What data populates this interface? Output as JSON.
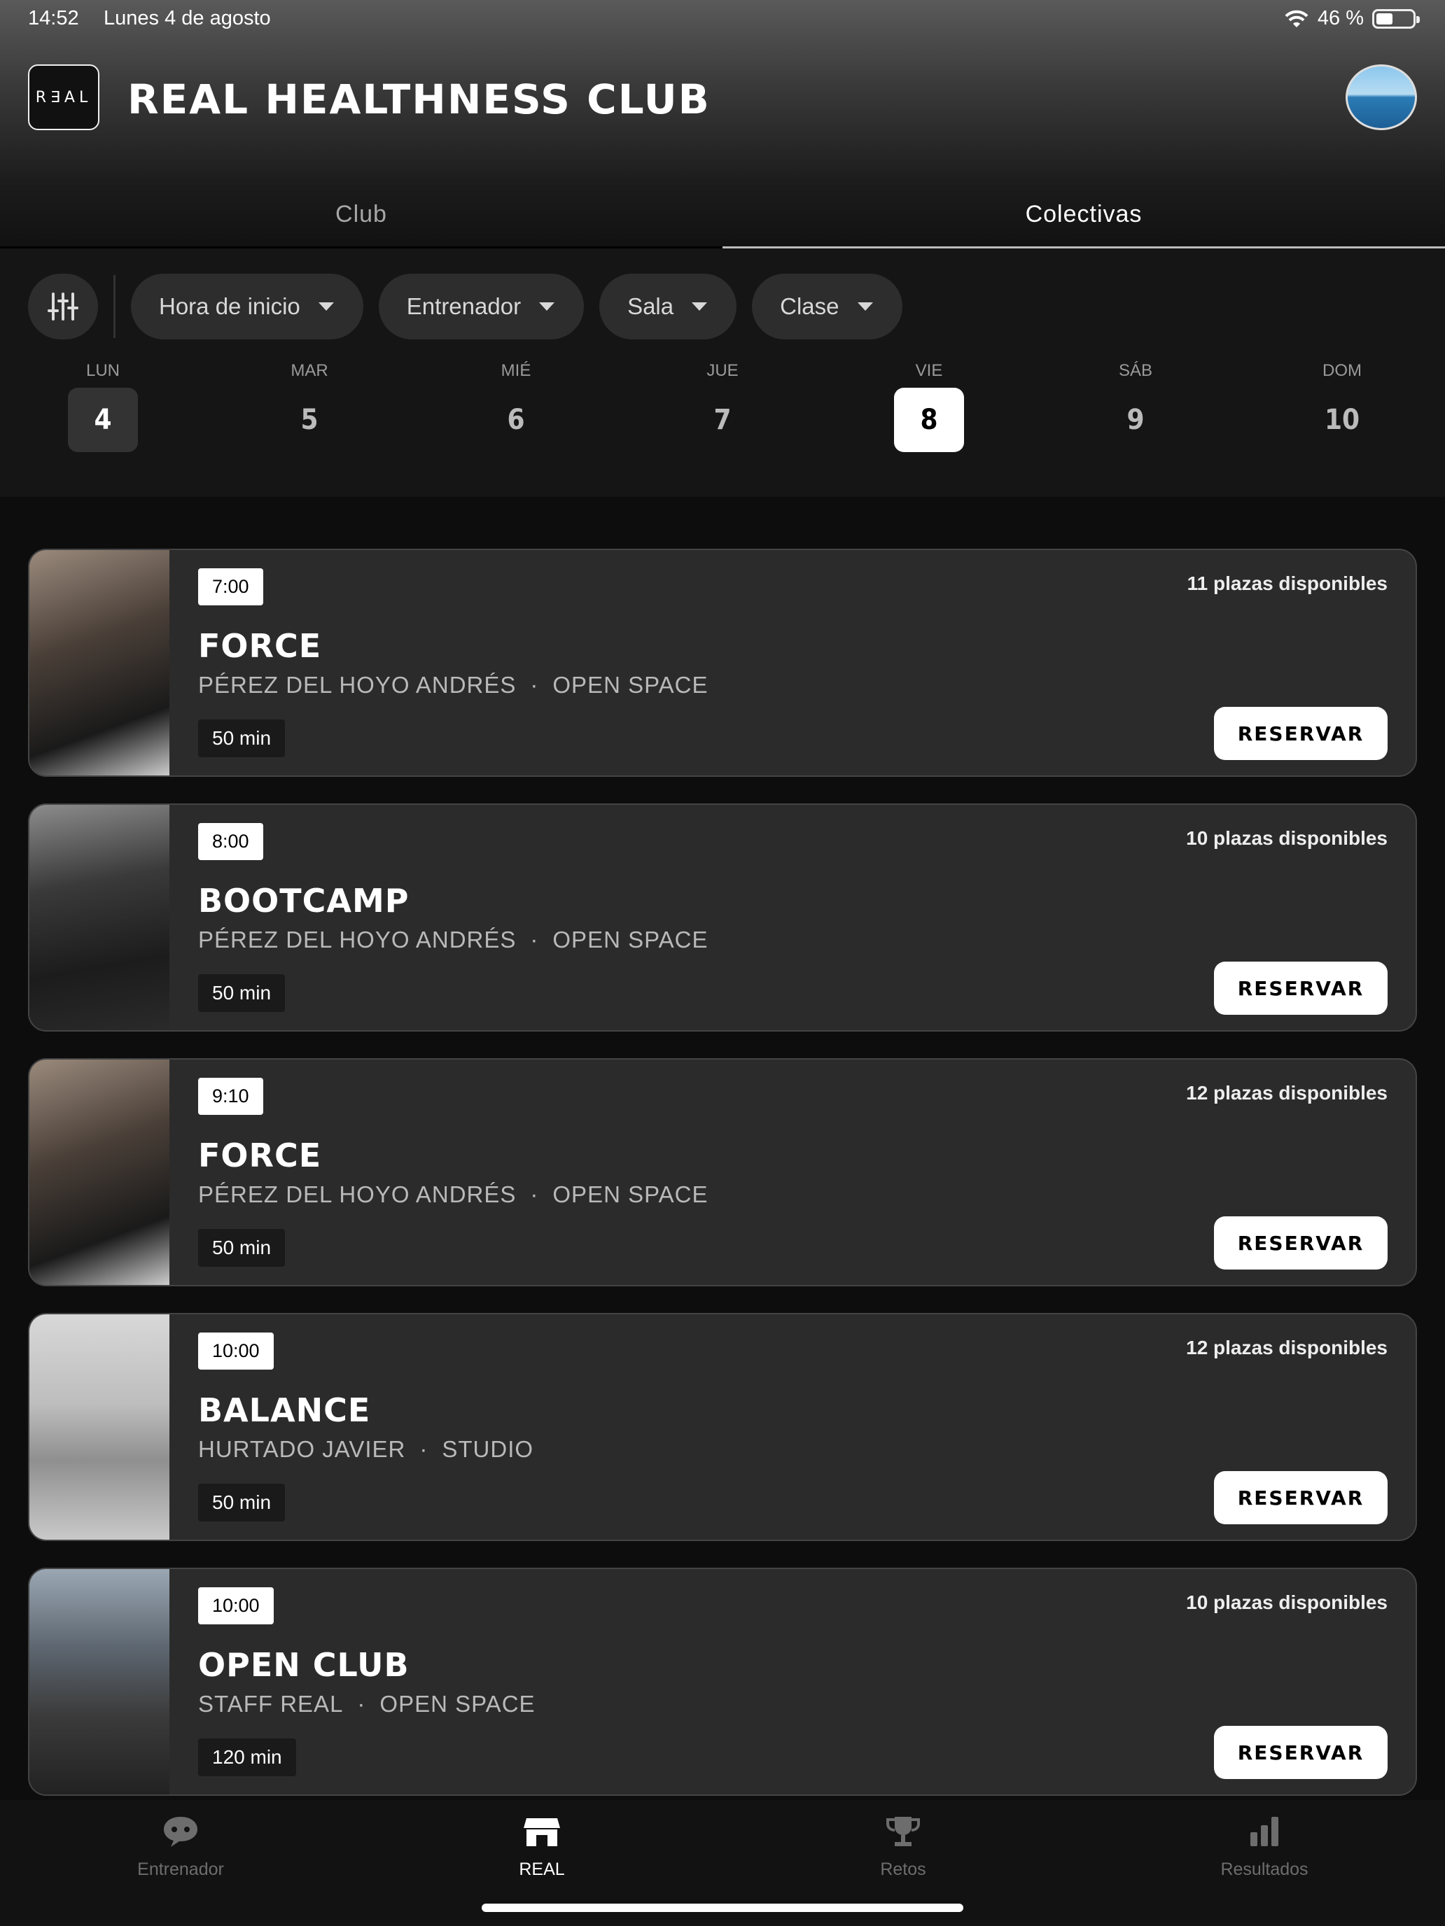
{
  "status": {
    "time": "14:52",
    "date": "Lunes 4 de agosto",
    "battery": "46 %",
    "battery_level": 0.46
  },
  "header": {
    "logo_text": "R∃AL",
    "title": "REAL HEALTHNESS CLUB",
    "avatar": "profile-avatar"
  },
  "tabs": [
    {
      "label": "Club",
      "active": false
    },
    {
      "label": "Colectivas",
      "active": true
    }
  ],
  "filters": {
    "icon": "sliders-icon",
    "chips": [
      {
        "label": "Hora de inicio"
      },
      {
        "label": "Entrenador"
      },
      {
        "label": "Sala"
      },
      {
        "label": "Clase"
      }
    ]
  },
  "days": [
    {
      "name": "LUN",
      "num": "4",
      "state": "today"
    },
    {
      "name": "MAR",
      "num": "5",
      "state": ""
    },
    {
      "name": "MIÉ",
      "num": "6",
      "state": ""
    },
    {
      "name": "JUE",
      "num": "7",
      "state": ""
    },
    {
      "name": "VIE",
      "num": "8",
      "state": "selected"
    },
    {
      "name": "SÁB",
      "num": "9",
      "state": ""
    },
    {
      "name": "DOM",
      "num": "10",
      "state": ""
    }
  ],
  "classes": [
    {
      "time": "7:00",
      "name": "FORCE",
      "trainer": "PÉREZ DEL HOYO ANDRÉS",
      "room": "OPEN SPACE",
      "duration": "50 min",
      "places": "11 plazas disponibles",
      "button": "RESERVAR"
    },
    {
      "time": "8:00",
      "name": "BOOTCAMP",
      "trainer": "PÉREZ DEL HOYO ANDRÉS",
      "room": "OPEN SPACE",
      "duration": "50 min",
      "places": "10 plazas disponibles",
      "button": "RESERVAR"
    },
    {
      "time": "9:10",
      "name": "FORCE",
      "trainer": "PÉREZ DEL HOYO ANDRÉS",
      "room": "OPEN SPACE",
      "duration": "50 min",
      "places": "12 plazas disponibles",
      "button": "RESERVAR"
    },
    {
      "time": "10:00",
      "name": "BALANCE",
      "trainer": "HURTADO JAVIER",
      "room": "STUDIO",
      "duration": "50 min",
      "places": "12 plazas disponibles",
      "button": "RESERVAR"
    },
    {
      "time": "10:00",
      "name": "OPEN CLUB",
      "trainer": "STAFF REAL",
      "room": "OPEN SPACE",
      "duration": "120 min",
      "places": "10 plazas disponibles",
      "button": "RESERVAR"
    }
  ],
  "separator": "·",
  "tabbar": [
    {
      "label": "Entrenador",
      "icon": "chat-bubble-icon",
      "active": false
    },
    {
      "label": "REAL",
      "icon": "store-icon",
      "active": true
    },
    {
      "label": "Retos",
      "icon": "trophy-icon",
      "active": false
    },
    {
      "label": "Resultados",
      "icon": "bar-chart-icon",
      "active": false
    }
  ],
  "colors": {
    "background": "#0d0d0d",
    "card": "#2b2b2b",
    "accent": "#ffffff",
    "muted": "#6d6d6d"
  }
}
